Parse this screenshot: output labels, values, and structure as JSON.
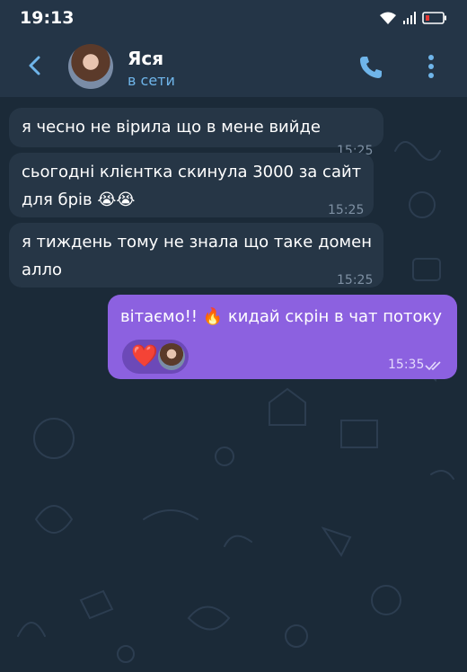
{
  "status_bar": {
    "time": "19:13"
  },
  "header": {
    "name": "Яся",
    "presence": "в сети"
  },
  "messages": [
    {
      "text": "я чесно не вірила що в мене вийде",
      "time": "15:25"
    },
    {
      "text": "сьогодні клієнтка скинула 3000 за сайт\nдля брів 😭😭",
      "time": "15:25"
    },
    {
      "text": "я тиждень тому не знала що таке домен\nалло",
      "time": "15:25"
    }
  ],
  "outgoing": {
    "text": "вітаємо!! 🔥 кидай скрін в чат потоку",
    "reaction": "❤️",
    "time": "15:35"
  },
  "colors": {
    "header_bg": "#243547",
    "chat_bg": "#1b2a38",
    "incoming_bubble": "#263646",
    "outgoing_bubble": "#8c61e0",
    "accent": "#6fb5ea"
  },
  "icons": [
    "back-arrow-icon",
    "phone-icon",
    "more-vert-icon",
    "wifi-icon",
    "signal-icon",
    "battery-icon",
    "double-check-icon"
  ]
}
